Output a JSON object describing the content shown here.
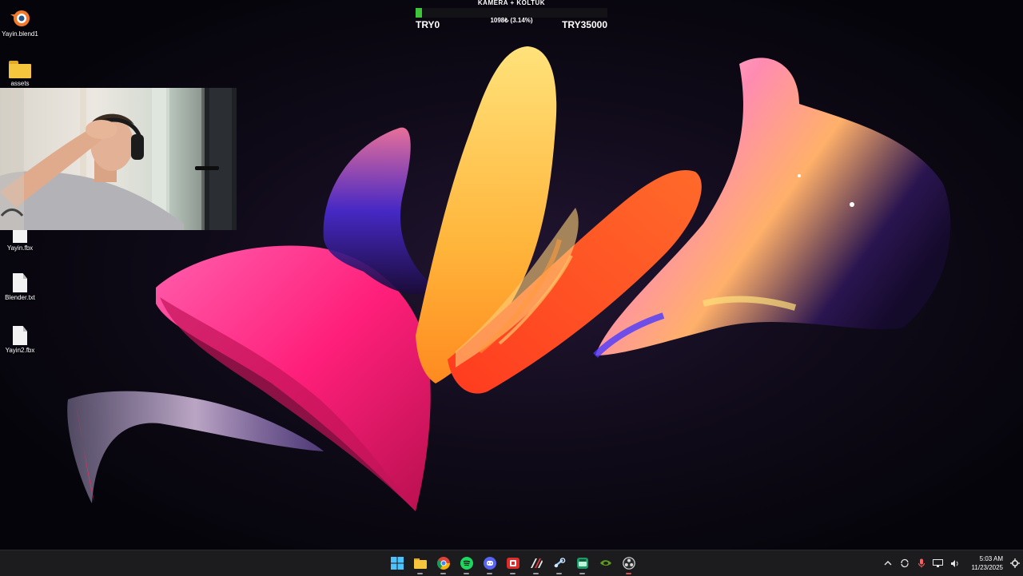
{
  "desktop": {
    "icons": [
      {
        "label": "Yayin.blend1",
        "icon": "blender-icon"
      },
      {
        "label": "assets",
        "icon": "folder-icon"
      },
      {
        "label": "Yayin.fbx",
        "icon": "file-icon"
      },
      {
        "label": "Blender.txt",
        "icon": "text-file-icon"
      },
      {
        "label": "Yayin2.fbx",
        "icon": "file-icon"
      }
    ]
  },
  "donation_goal": {
    "title": "KAMERA + KOLTUK",
    "amount": "1098₺ (3.14%)",
    "progress": 0.0314,
    "min_label": "TRY0",
    "max_label": "TRY35000",
    "bar_color": "#3ec43a"
  },
  "taskbar": {
    "apps": [
      {
        "name": "start-icon"
      },
      {
        "name": "file-explorer-icon"
      },
      {
        "name": "chrome-icon"
      },
      {
        "name": "spotify-icon"
      },
      {
        "name": "discord-icon"
      },
      {
        "name": "red-app-icon"
      },
      {
        "name": "stripes-app-icon"
      },
      {
        "name": "steam-icon"
      },
      {
        "name": "green-app-icon"
      },
      {
        "name": "nvidia-icon"
      },
      {
        "name": "obs-icon"
      }
    ],
    "tray": {
      "time": "5:03 AM",
      "date": "11/23/2025"
    }
  },
  "colors": {
    "accent_pink": "#ff2d8a",
    "accent_orange": "#ff6a1a",
    "accent_yellow": "#ffb63a",
    "taskbar_bg": "#1c1c1f"
  }
}
